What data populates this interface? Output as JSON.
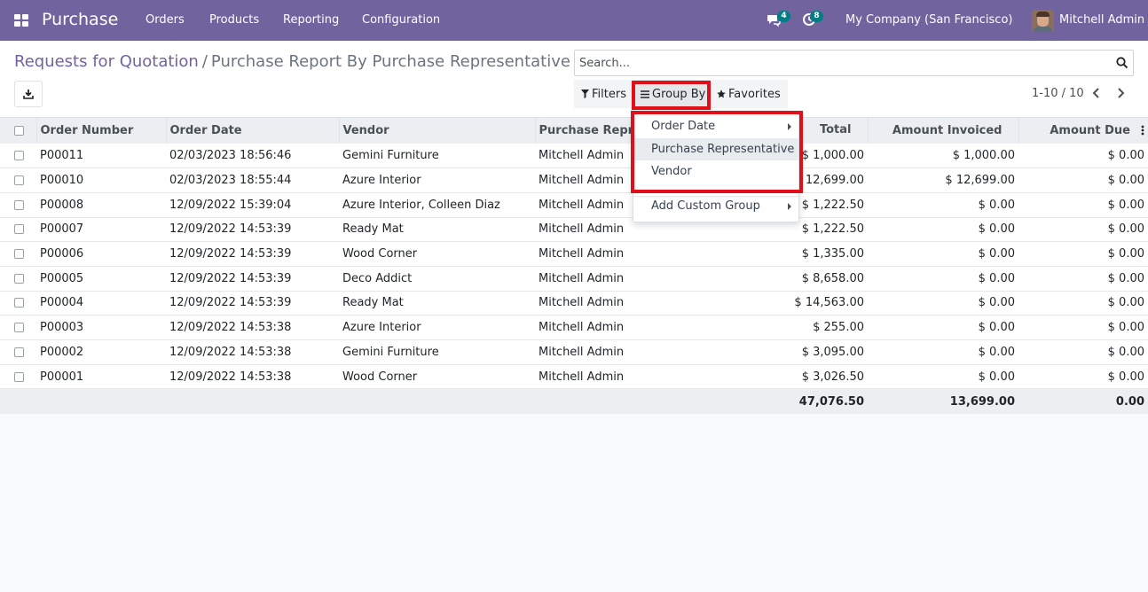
{
  "app": {
    "name": "Purchase",
    "menu": [
      "Orders",
      "Products",
      "Reporting",
      "Configuration"
    ],
    "messages_count": "4",
    "activities_count": "8",
    "company": "My Company (San Francisco)",
    "user": "Mitchell Admin"
  },
  "breadcrumb": {
    "parent": "Requests for Quotation",
    "separator": "/",
    "current": "Purchase Report By Purchase Representative"
  },
  "search": {
    "placeholder": "Search..."
  },
  "filters": {
    "filters": "Filters",
    "group_by": "Group By",
    "favorites": "Favorites"
  },
  "pager": {
    "text": "1-10 / 10"
  },
  "table": {
    "columns": [
      "Order Number",
      "Order Date",
      "Vendor",
      "Purchase Representative",
      "Total",
      "Amount Invoiced",
      "Amount Due"
    ],
    "rows": [
      [
        "P00011",
        "02/03/2023 18:56:46",
        "Gemini Furniture",
        "Mitchell Admin",
        "$ 1,000.00",
        "$ 1,000.00",
        "$ 0.00"
      ],
      [
        "P00010",
        "02/03/2023 18:55:44",
        "Azure Interior",
        "Mitchell Admin",
        "$ 12,699.00",
        "$ 12,699.00",
        "$ 0.00"
      ],
      [
        "P00008",
        "12/09/2022 15:39:04",
        "Azure Interior, Colleen Diaz",
        "Mitchell Admin",
        "$ 1,222.50",
        "$ 0.00",
        "$ 0.00"
      ],
      [
        "P00007",
        "12/09/2022 14:53:39",
        "Ready Mat",
        "Mitchell Admin",
        "$ 1,222.50",
        "$ 0.00",
        "$ 0.00"
      ],
      [
        "P00006",
        "12/09/2022 14:53:39",
        "Wood Corner",
        "Mitchell Admin",
        "$ 1,335.00",
        "$ 0.00",
        "$ 0.00"
      ],
      [
        "P00005",
        "12/09/2022 14:53:39",
        "Deco Addict",
        "Mitchell Admin",
        "$ 8,658.00",
        "$ 0.00",
        "$ 0.00"
      ],
      [
        "P00004",
        "12/09/2022 14:53:39",
        "Ready Mat",
        "Mitchell Admin",
        "$ 14,563.00",
        "$ 0.00",
        "$ 0.00"
      ],
      [
        "P00003",
        "12/09/2022 14:53:38",
        "Azure Interior",
        "Mitchell Admin",
        "$ 255.00",
        "$ 0.00",
        "$ 0.00"
      ],
      [
        "P00002",
        "12/09/2022 14:53:38",
        "Gemini Furniture",
        "Mitchell Admin",
        "$ 3,095.00",
        "$ 0.00",
        "$ 0.00"
      ],
      [
        "P00001",
        "12/09/2022 14:53:38",
        "Wood Corner",
        "Mitchell Admin",
        "$ 3,026.50",
        "$ 0.00",
        "$ 0.00"
      ]
    ],
    "totals": {
      "total": "47,076.50",
      "invoiced": "13,699.00",
      "due": "0.00"
    }
  },
  "group_by_menu": {
    "items": [
      "Order Date",
      "Purchase Representative",
      "Vendor"
    ],
    "custom": "Add Custom Group"
  },
  "colors": {
    "navbar": "#71639e",
    "highlight_box": "#e0101a",
    "badge": "#017e84"
  }
}
